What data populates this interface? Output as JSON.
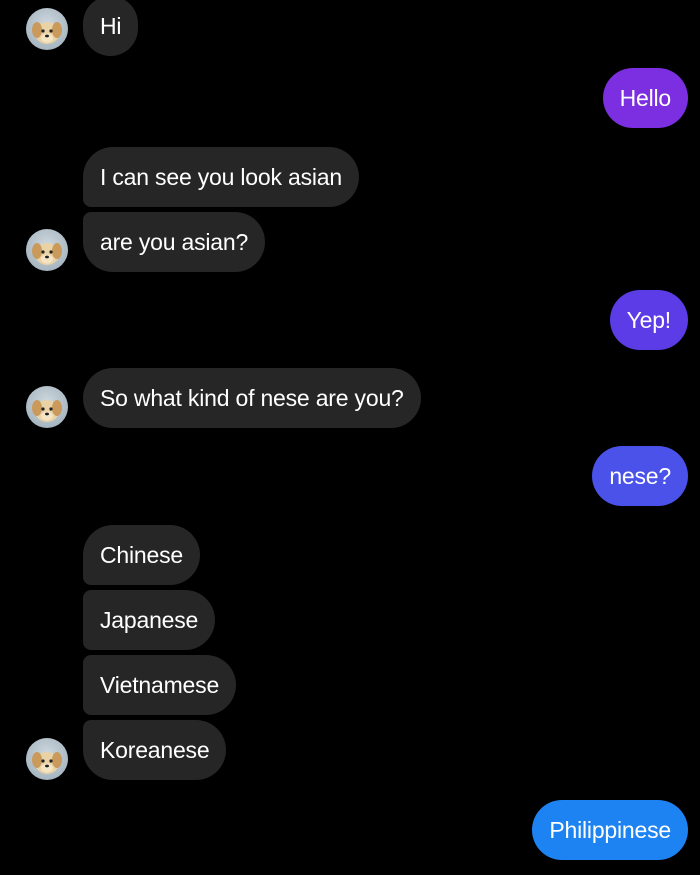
{
  "messages": [
    {
      "side": "in",
      "text": "Hi"
    },
    {
      "side": "out",
      "text": "Hello"
    },
    {
      "side": "in",
      "text": "I can see you look asian"
    },
    {
      "side": "in",
      "text": "are you asian?"
    },
    {
      "side": "out",
      "text": "Yep!"
    },
    {
      "side": "in",
      "text": "So what kind of nese are you?"
    },
    {
      "side": "out",
      "text": "nese?"
    },
    {
      "side": "in",
      "text": "Chinese"
    },
    {
      "side": "in",
      "text": "Japanese"
    },
    {
      "side": "in",
      "text": "Vietnamese"
    },
    {
      "side": "in",
      "text": "Koreanese"
    },
    {
      "side": "out",
      "text": "Philippinese"
    }
  ],
  "avatar": {
    "icon": "puppy-avatar-icon"
  },
  "colors": {
    "page_background": "#000000",
    "incoming_bubble": "#262626",
    "outgoing_gradient": [
      "#7b2fe0",
      "#5b3ce6",
      "#4b52ea",
      "#2f6fee",
      "#1d83f2"
    ]
  }
}
